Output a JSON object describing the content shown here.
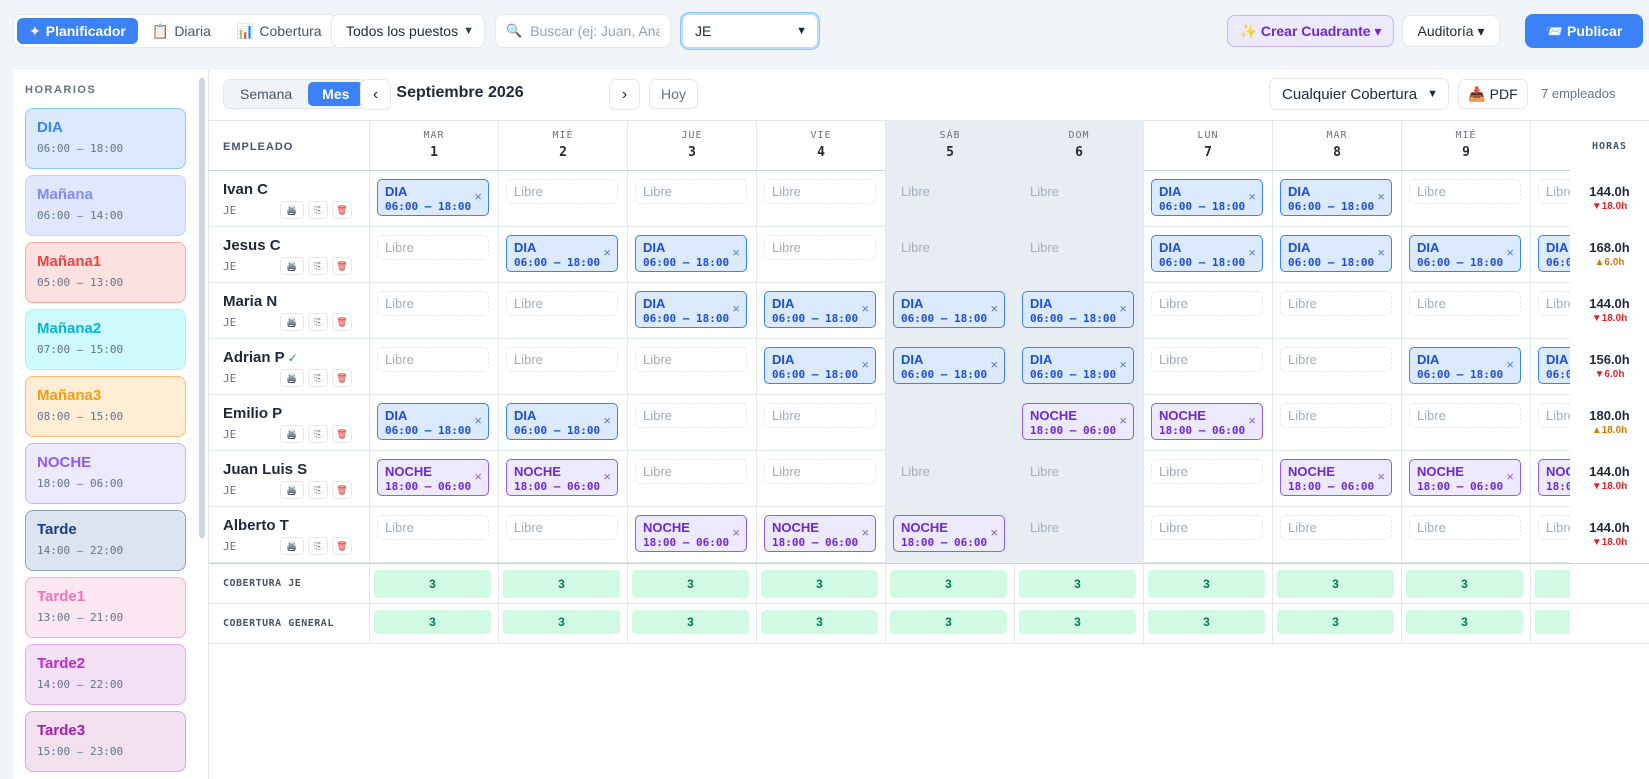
{
  "nav": {
    "tabs": [
      {
        "label": "Planificador",
        "icon": "✦"
      },
      {
        "label": "Diaria",
        "icon": "📋"
      },
      {
        "label": "Cobertura",
        "icon": "📊"
      }
    ],
    "puestos_select": "Todos los puestos",
    "search_placeholder": "Buscar (ej: Juan, Ana)",
    "je_select": "JE",
    "crear_label": "✨ Crear Cuadrante ▾",
    "audit_label": "Auditoría ▾",
    "publicar_label": "📨 Publicar"
  },
  "sidebar": {
    "title": "HORARIOS",
    "shifts": [
      {
        "name": "DIA",
        "time": "06:00 – 18:00",
        "bg": "#dbeafe",
        "border": "#93c5fd",
        "color": "#3b82f6"
      },
      {
        "name": "Mañana",
        "time": "06:00 – 14:00",
        "bg": "#e0e7ff",
        "border": "#c7d2fe",
        "color": "#818cf8"
      },
      {
        "name": "Mañana1",
        "time": "05:00 – 13:00",
        "bg": "#fee2e2",
        "border": "#fca5a5",
        "color": "#ef4444"
      },
      {
        "name": "Mañana2",
        "time": "07:00 – 15:00",
        "bg": "#cffafe",
        "border": "#a5f3fc",
        "color": "#06b6d4"
      },
      {
        "name": "Mañana3",
        "time": "08:00 – 15:00",
        "bg": "#ffedd5",
        "border": "#fdba74",
        "color": "#f59e0b"
      },
      {
        "name": "NOCHE",
        "time": "18:00 – 06:00",
        "bg": "#ede9fe",
        "border": "#c4b5fd",
        "color": "#8b5cf6"
      },
      {
        "name": "Tarde",
        "time": "14:00 – 22:00",
        "bg": "#dbe4f0",
        "border": "#94a3b8",
        "color": "#1e3a8a"
      },
      {
        "name": "Tarde1",
        "time": "13:00 – 21:00",
        "bg": "#fce7f3",
        "border": "#f9a8d4",
        "color": "#f472b6"
      },
      {
        "name": "Tarde2",
        "time": "14:00 – 22:00",
        "bg": "#f5e1f7",
        "border": "#e9a8ef",
        "color": "#c026d3"
      },
      {
        "name": "Tarde3",
        "time": "15:00 – 23:00",
        "bg": "#f3e1f0",
        "border": "#d8a4d0",
        "color": "#a21caf"
      }
    ]
  },
  "toolbar": {
    "semana": "Semana",
    "mes": "Mes",
    "prev": "‹",
    "next": "›",
    "month": "Septiembre 2026",
    "hoy": "Hoy",
    "coverage_select": "Cualquier Cobertura",
    "pdf": "📥 PDF",
    "emp_count": "7 empleados"
  },
  "grid": {
    "emp_header": "EMPLEADO",
    "hours_header": "HORAS",
    "libre": "Libre",
    "days": [
      {
        "dw": "MAR",
        "dn": "1",
        "weekend": false
      },
      {
        "dw": "MIÉ",
        "dn": "2",
        "weekend": false
      },
      {
        "dw": "JUE",
        "dn": "3",
        "weekend": false
      },
      {
        "dw": "VIE",
        "dn": "4",
        "weekend": false
      },
      {
        "dw": "SÁB",
        "dn": "5",
        "weekend": true
      },
      {
        "dw": "DOM",
        "dn": "6",
        "weekend": true
      },
      {
        "dw": "LUN",
        "dn": "7",
        "weekend": false
      },
      {
        "dw": "MAR",
        "dn": "8",
        "weekend": false
      },
      {
        "dw": "MIÉ",
        "dn": "9",
        "weekend": false
      },
      {
        "dw": "",
        "dn": "",
        "weekend": false
      }
    ],
    "shift_types": {
      "D": {
        "name": "DIA",
        "time": "06:00 – 18:00",
        "cls": "dia"
      },
      "N": {
        "name": "NOCHE",
        "time": "18:00 – 06:00",
        "cls": "noche"
      }
    },
    "employees": [
      {
        "name": "Ivan C",
        "check": false,
        "pos": "JE",
        "cells": [
          "D",
          "L",
          "L",
          "L",
          "L",
          "L",
          "D",
          "D",
          "L",
          "L"
        ],
        "hours": "144.0h",
        "delta": "▼18.0h",
        "dir": "down"
      },
      {
        "name": "Jesus C",
        "check": false,
        "pos": "JE",
        "cells": [
          "L",
          "D",
          "D",
          "L",
          "L",
          "L",
          "D",
          "D",
          "D",
          "D"
        ],
        "hours": "168.0h",
        "delta": "▲6.0h",
        "dir": "up"
      },
      {
        "name": "Maria N",
        "check": false,
        "pos": "JE",
        "cells": [
          "L",
          "L",
          "D",
          "D",
          "D",
          "D",
          "L",
          "L",
          "L",
          "L"
        ],
        "hours": "144.0h",
        "delta": "▼18.0h",
        "dir": "down"
      },
      {
        "name": "Adrian P",
        "check": true,
        "pos": "JE",
        "cells": [
          "L",
          "L",
          "L",
          "D",
          "D",
          "D",
          "L",
          "L",
          "D",
          "D"
        ],
        "hours": "156.0h",
        "delta": "▼6.0h",
        "dir": "down"
      },
      {
        "name": "Emilio P",
        "check": false,
        "pos": "JE",
        "cells": [
          "D",
          "D",
          "L",
          "L",
          "E",
          "N",
          "N",
          "L",
          "L",
          "L"
        ],
        "hours": "180.0h",
        "delta": "▲18.0h",
        "dir": "up"
      },
      {
        "name": "Juan Luis S",
        "check": false,
        "pos": "JE",
        "cells": [
          "N",
          "N",
          "L",
          "L",
          "L",
          "L",
          "L",
          "N",
          "N",
          "N"
        ],
        "hours": "144.0h",
        "delta": "▼18.0h",
        "dir": "down"
      },
      {
        "name": "Alberto T",
        "check": false,
        "pos": "JE",
        "cells": [
          "L",
          "L",
          "N",
          "N",
          "N",
          "L",
          "L",
          "L",
          "L",
          "L"
        ],
        "hours": "144.0h",
        "delta": "▼18.0h",
        "dir": "down"
      }
    ],
    "coverage_rows": [
      {
        "label": "COBERTURA JE",
        "values": [
          "3",
          "3",
          "3",
          "3",
          "3",
          "3",
          "3",
          "3",
          "3",
          ""
        ]
      },
      {
        "label": "COBERTURA GENERAL",
        "values": [
          "3",
          "3",
          "3",
          "3",
          "3",
          "3",
          "3",
          "3",
          "3",
          ""
        ]
      }
    ],
    "emp_icons": {
      "print": "🖨️",
      "copy": "⎘",
      "delete": "🗑"
    },
    "check_mark": "✓"
  }
}
